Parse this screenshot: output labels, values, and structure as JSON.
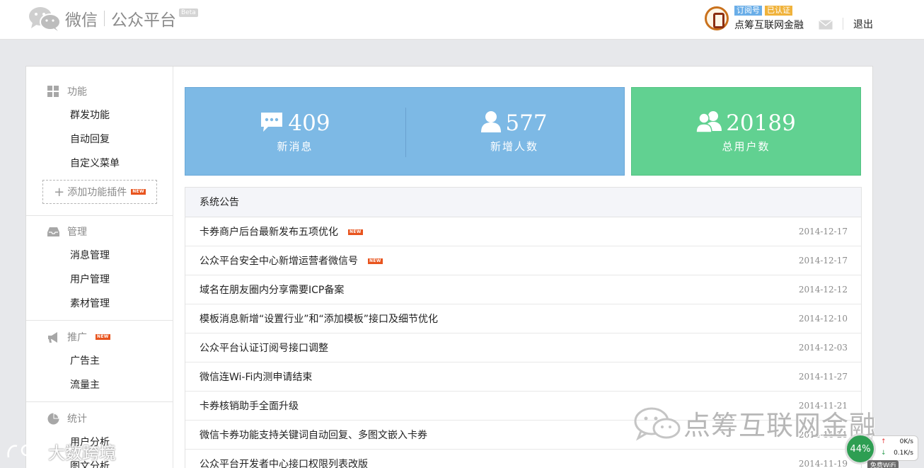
{
  "header": {
    "brand_name": "微信",
    "platform_name": "公众平台",
    "beta": "Beta",
    "account": {
      "type_badge": "订阅号",
      "verified_badge": "已认证",
      "name": "点筹互联网金融"
    },
    "logout": "退出"
  },
  "sidebar": {
    "sections": [
      {
        "title": "功能",
        "icon": "grid-icon",
        "items": [
          "群发功能",
          "自动回复",
          "自定义菜单"
        ],
        "add_plugin": "添加功能插件",
        "add_plugin_new": "NEW"
      },
      {
        "title": "管理",
        "icon": "inbox-icon",
        "items": [
          "消息管理",
          "用户管理",
          "素材管理"
        ]
      },
      {
        "title": "推广",
        "icon": "megaphone-icon",
        "title_new": "NEW",
        "items": [
          "广告主",
          "流量主"
        ]
      },
      {
        "title": "统计",
        "icon": "pie-chart-icon",
        "items": [
          "用户分析",
          "图文分析"
        ]
      }
    ]
  },
  "stats": {
    "messages": {
      "value": "409",
      "label": "新消息",
      "icon": "chat-icon"
    },
    "new_users": {
      "value": "577",
      "label": "新增人数",
      "icon": "user-icon"
    },
    "total_users": {
      "value": "20189",
      "label": "总用户数",
      "icon": "users-icon"
    },
    "colors": {
      "blue": "#7db9e5",
      "green": "#61d191"
    }
  },
  "notice": {
    "title": "系统公告",
    "new_tag": "NEW",
    "items": [
      {
        "title": "卡券商户后台最新发布五项优化",
        "date": "2014-12-17",
        "is_new": true
      },
      {
        "title": "公众平台安全中心新增运营者微信号",
        "date": "2014-12-17",
        "is_new": true
      },
      {
        "title": "域名在朋友圈内分享需要ICP备案",
        "date": "2014-12-12",
        "is_new": false
      },
      {
        "title": "模板消息新增“设置行业”和“添加模板”接口及细节优化",
        "date": "2014-12-10",
        "is_new": false
      },
      {
        "title": "公众平台认证订阅号接口调整",
        "date": "2014-12-03",
        "is_new": false
      },
      {
        "title": "微信连Wi-Fi内测申请结束",
        "date": "2014-11-27",
        "is_new": false
      },
      {
        "title": "卡券核销助手全面升级",
        "date": "2014-11-21",
        "is_new": false
      },
      {
        "title": "微信卡券功能支持关键词自动回复、多图文嵌入卡券",
        "date": "2014-11-21",
        "is_new": false
      },
      {
        "title": "公众平台开发者中心接口权限列表改版",
        "date": "2014-11-19",
        "is_new": false
      }
    ]
  },
  "overlays": {
    "watermark_text": "点筹互联网金融",
    "corner_watermark": "大数跨境",
    "speed_percent": "44%",
    "speed_up": "0K/s",
    "speed_down": "0.1K/s",
    "wifi": "免费WiFi"
  }
}
